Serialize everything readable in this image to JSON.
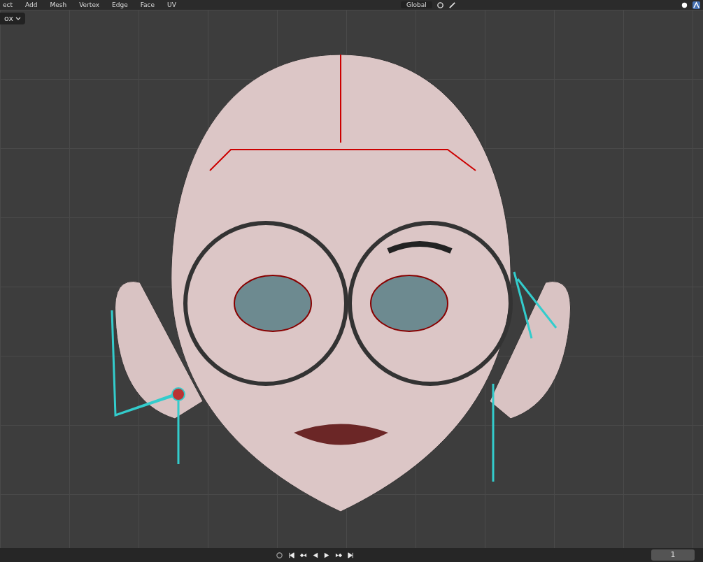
{
  "header": {
    "menus": [
      "ect",
      "Add",
      "Mesh",
      "Vertex",
      "Edge",
      "Face",
      "UV"
    ],
    "orientation": "Global"
  },
  "select_box": {
    "label": "ox"
  },
  "timeline": {
    "frame": "1"
  }
}
